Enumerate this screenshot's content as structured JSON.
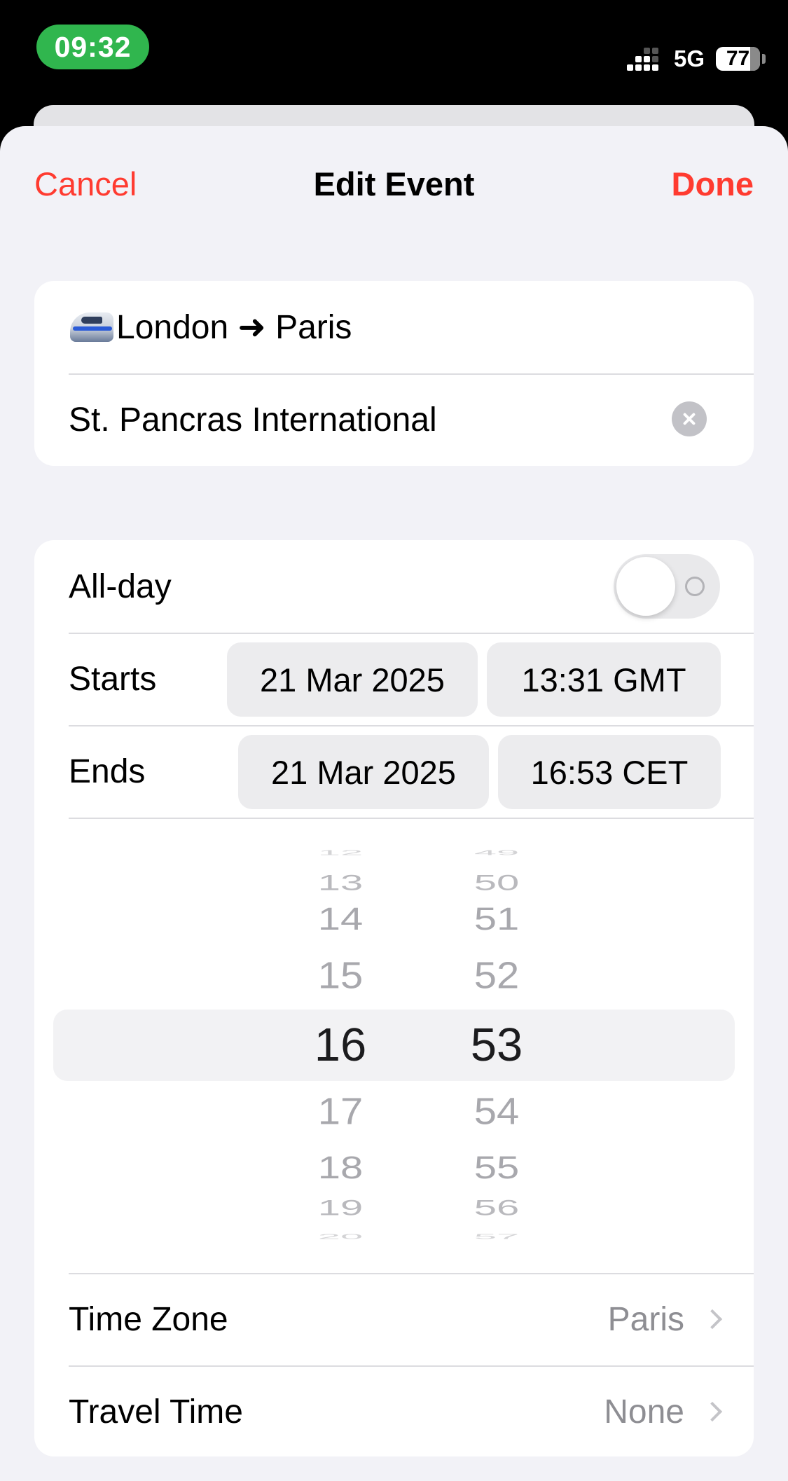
{
  "status_bar": {
    "time": "09:32",
    "network": "5G",
    "battery": "77"
  },
  "nav": {
    "cancel": "Cancel",
    "title": "Edit Event",
    "done": "Done"
  },
  "event": {
    "title": "London ➜ Paris",
    "title_icon": "high-speed-train-emoji",
    "location": "St. Pancras International"
  },
  "all_day": {
    "label": "All-day",
    "enabled": false
  },
  "starts": {
    "label": "Starts",
    "date": "21 Mar 2025",
    "time": "13:31 GMT"
  },
  "ends": {
    "label": "Ends",
    "date": "21 Mar 2025",
    "time": "16:53 CET"
  },
  "time_picker": {
    "hours": [
      "12",
      "13",
      "14",
      "15",
      "16",
      "17",
      "18",
      "19",
      "20"
    ],
    "minutes": [
      "49",
      "50",
      "51",
      "52",
      "53",
      "54",
      "55",
      "56",
      "57"
    ],
    "selected_hour": "16",
    "selected_minute": "53"
  },
  "time_zone": {
    "label": "Time Zone",
    "value": "Paris"
  },
  "travel_time": {
    "label": "Travel Time",
    "value": "None"
  },
  "colors": {
    "accent": "#ff3b30",
    "status_pill": "#30b64e",
    "background": "#f2f2f7"
  }
}
